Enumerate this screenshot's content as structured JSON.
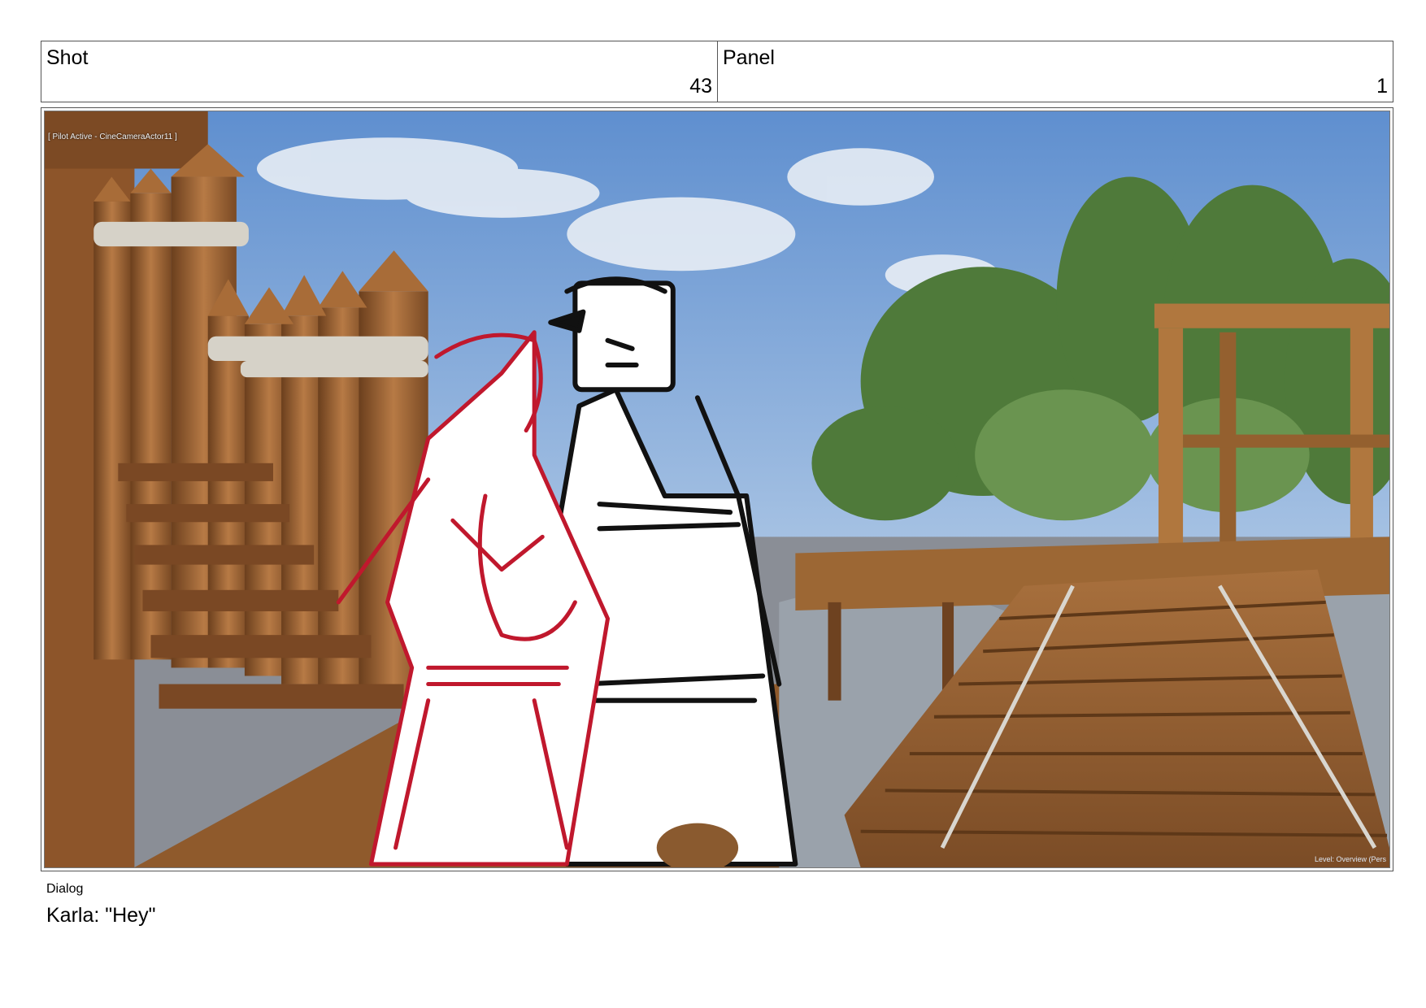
{
  "header": {
    "shot_label": "Shot",
    "shot_value": "43",
    "panel_label": "Panel",
    "panel_value": "1"
  },
  "frame": {
    "viewport_label": "[ Pilot Active - CineCameraActor11 ]",
    "level_label": "Level: Overview (Pers"
  },
  "dialog": {
    "label": "Dialog",
    "text": "Karla: \"Hey\""
  },
  "colors": {
    "sky": "#8fb3dc",
    "wood": "#9a6233",
    "sketch_red": "#c0182d",
    "sketch_black": "#111111",
    "foliage": "#4f7a3a"
  }
}
